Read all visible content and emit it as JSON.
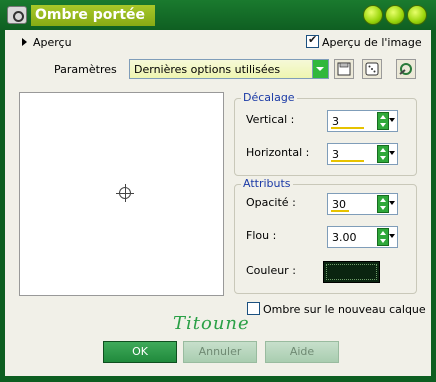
{
  "window": {
    "title": "Ombre portée",
    "controls": [
      "minimize",
      "maximize",
      "close"
    ]
  },
  "preview_toggle": {
    "label": "Aperçu"
  },
  "preview_image_checkbox": {
    "label": "Aperçu de l'image",
    "checked": true
  },
  "params": {
    "label": "Paramètres",
    "selected": "Dernières options utilisées",
    "icons": [
      "save-preset-icon",
      "random-dice-icon",
      "reset-icon"
    ]
  },
  "offset_group": {
    "title": "Décalage",
    "vertical_label": "Vertical :",
    "vertical_value": "3",
    "horizontal_label": "Horizontal :",
    "horizontal_value": "3"
  },
  "attributes_group": {
    "title": "Attributs",
    "opacity_label": "Opacité :",
    "opacity_value": "30",
    "blur_label": "Flou :",
    "blur_value": "3.00",
    "color_label": "Couleur :",
    "color": "#0a2410"
  },
  "new_layer_checkbox": {
    "label": "Ombre sur le nouveau calque",
    "checked": false
  },
  "signature": "Titoune",
  "buttons": {
    "ok": "OK",
    "cancel": "Annuler",
    "help": "Aide"
  },
  "colors": {
    "frame": "#0d5e20",
    "accent": "#a8c82a",
    "group_title": "#1b3aa6"
  }
}
